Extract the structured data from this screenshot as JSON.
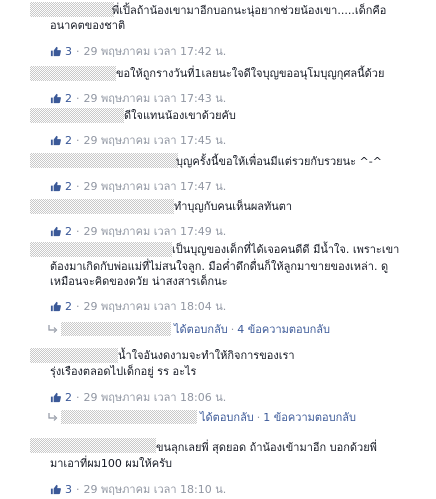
{
  "comments": [
    {
      "text_lines": [
        "พี่เปิ้ลถ้าน้องเขามาอีกบอกนะนุ่อยากช่วยน้องเขา.....เด็กคือ",
        "อนาคตของชาติ"
      ],
      "likes": "3",
      "separator": "·",
      "timestamp": "29 พฤษภาคม เวลา 17:42 น."
    },
    {
      "text_lines": [
        "ขอให้ถูกรางวันที่1เลยนะใจดีใจบุญขออนุโมบุญกุศลนี้ด้วย"
      ],
      "likes": "2",
      "separator": "·",
      "timestamp": "29 พฤษภาคม เวลา 17:43 น."
    },
    {
      "text_lines": [
        "ดีใจแทนน้องเขาด้วยคับ"
      ],
      "likes": "2",
      "separator": "·",
      "timestamp": "29 พฤษภาคม เวลา 17:45 น."
    },
    {
      "text_lines": [
        "บุญครั้งนี้ขอให้เพื่อนมีแต่รวยกับรวยนะ ^-^"
      ],
      "likes": "2",
      "separator": "·",
      "timestamp": "29 พฤษภาคม เวลา 17:47 น."
    },
    {
      "text_lines": [
        "ทำบุญกับคนเห็นผลทันตา"
      ],
      "likes": "2",
      "separator": "·",
      "timestamp": "29 พฤษภาคม เวลา 17:49 น."
    },
    {
      "text_lines": [
        "เป็นบุญของเด็กที่ได้เจอคนดีดี มีน้ำใจ. เพราะเขา",
        "ต้องมาเกิดกับพ่อแม่ที่ไม่สนใจลูก. มือค่ำดึกดื่นก็ให้ลูกมาขายของเหล่า. ดู",
        "เหมือนจะคิดของดวัย น่าสงสารเด็กนะ"
      ],
      "likes": "2",
      "separator": "·",
      "timestamp": "29 พฤษภาคม เวลา 18:04 น.",
      "replies": {
        "reply_link": "ได้ตอบกลับ",
        "separator": "·",
        "count_text": "4 ข้อความตอบกลับ"
      }
    },
    {
      "text_lines": [
        "น้ำใจอันงดงามจะทำให้กิจการของเรา",
        "รุ่งเรืองตลอดไปเด็กอยู่ รร อะไร"
      ],
      "likes": "2",
      "separator": "·",
      "timestamp": "29 พฤษภาคม เวลา 18:06 น.",
      "replies": {
        "reply_link": "ได้ตอบกลับ",
        "separator": "·",
        "count_text": "1 ข้อความตอบกลับ"
      }
    },
    {
      "text_lines": [
        "ขนลุกเลยพี่ สุดยอด ถ้าน้องเข้ามาอีก บอกด้วยพี่",
        "มาเอาที่ผม100 ผมให้ครับ"
      ],
      "likes": "3",
      "separator": "·",
      "timestamp": "29 พฤษภาคม เวลา 18:10 น."
    }
  ],
  "icons": {
    "like": "thumbs-up-icon",
    "reply": "reply-arrow-icon"
  },
  "colors": {
    "link": "#3b5998",
    "meta": "#9197a3",
    "text": "#141823"
  }
}
